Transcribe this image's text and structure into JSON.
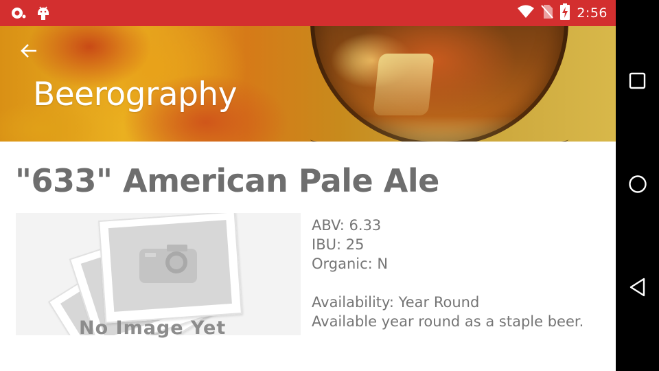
{
  "status_bar": {
    "time": "2:56",
    "left_icons": [
      "notification-dot-icon",
      "android-debug-icon"
    ],
    "right_icons": [
      "wifi-icon",
      "no-sim-icon",
      "battery-charging-icon"
    ],
    "background_color": "#d32f2f"
  },
  "app_bar": {
    "title": "Beerography",
    "back_icon": "arrow-back-icon"
  },
  "beer": {
    "name": "\"633\" American Pale Ale",
    "image_placeholder_text": "No Image Yet",
    "abv": "ABV: 6.33",
    "ibu": "IBU: 25",
    "organic": "Organic: N",
    "availability": "Availability: Year Round",
    "availability_description": "Available year round as a staple beer."
  },
  "nav_bar": {
    "buttons": [
      "recents-square-icon",
      "home-circle-icon",
      "back-triangle-icon"
    ]
  }
}
